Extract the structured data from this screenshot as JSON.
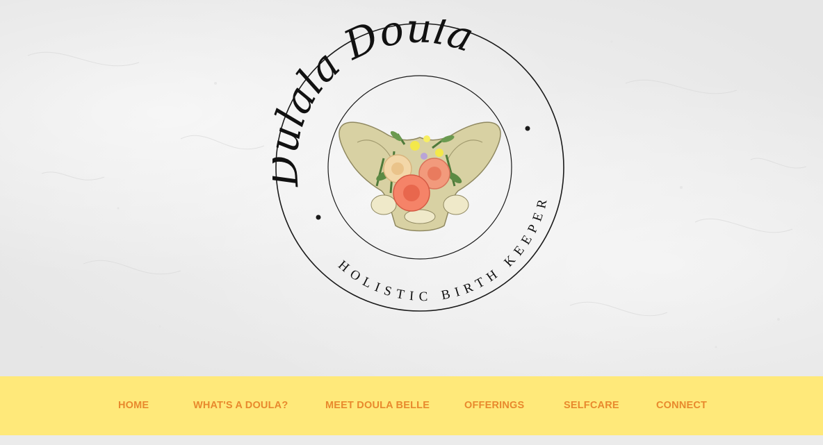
{
  "logo": {
    "script_text": "Dulala Doula",
    "ring_text": "HOLISTIC BIRTH KEEPER"
  },
  "nav": {
    "items": [
      {
        "label": "HOME"
      },
      {
        "label": "WHAT'S A DOULA?"
      },
      {
        "label": "MEET DOULA BELLE"
      },
      {
        "label": "OFFERINGS"
      },
      {
        "label": "SELFCARE"
      },
      {
        "label": "CONNECT"
      }
    ]
  },
  "colors": {
    "nav_background": "#ffe97a",
    "nav_text": "#e8892d",
    "hero_background": "#ececec"
  },
  "icons": [
    "pelvis-bone-illustration",
    "flower-bouquet"
  ]
}
